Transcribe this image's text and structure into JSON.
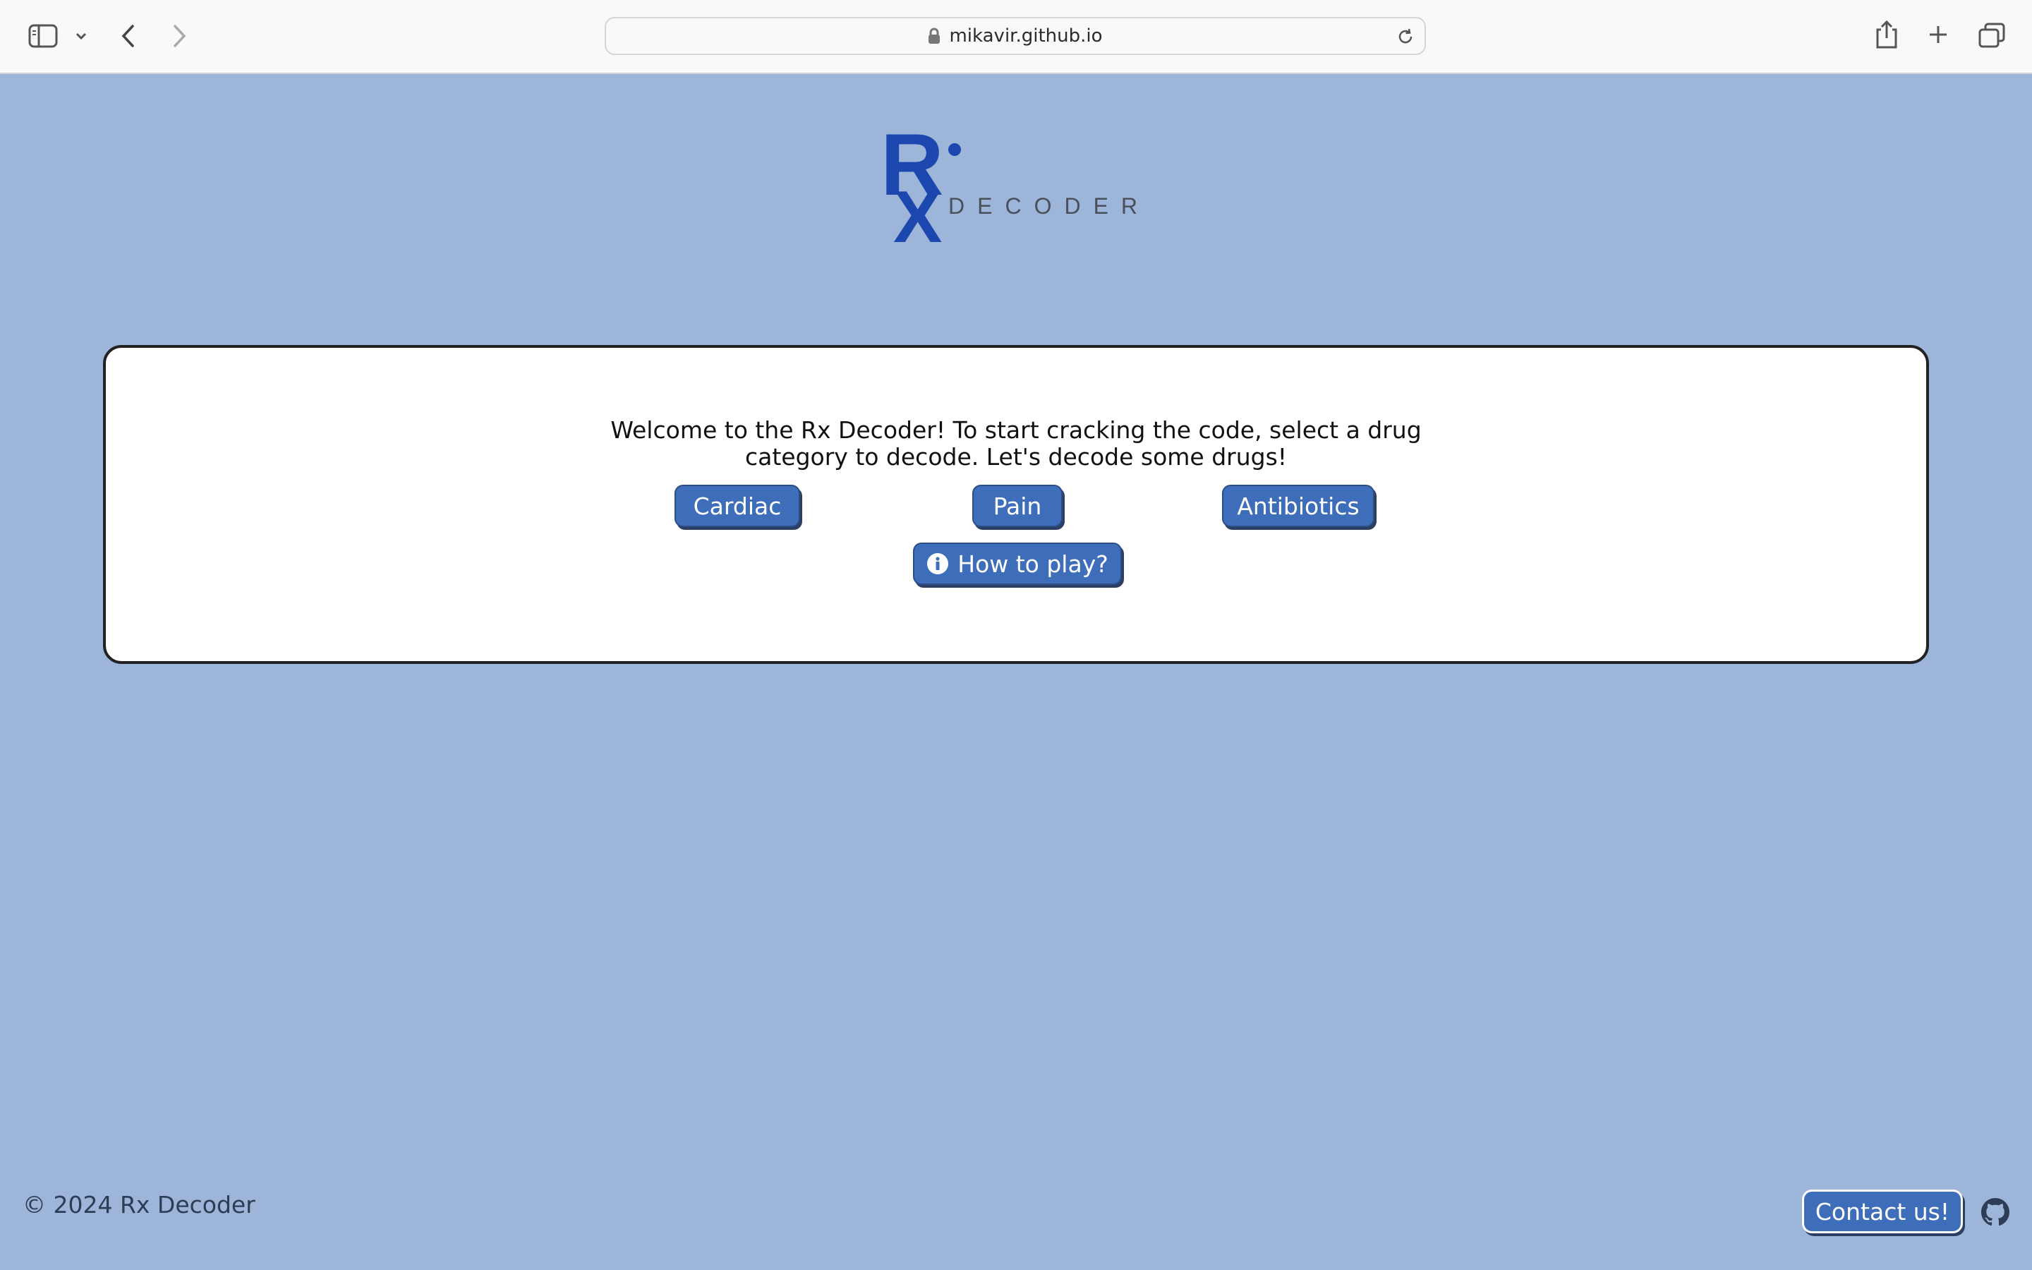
{
  "browser": {
    "url": "mikavir.github.io",
    "icons": [
      "sidebar-icon",
      "chevron-down-icon",
      "back-icon",
      "forward-icon",
      "lock-icon",
      "reload-icon",
      "share-icon",
      "new-tab-icon",
      "tabs-overview-icon"
    ]
  },
  "logo": {
    "mark": "Rx",
    "word": "DECODER",
    "brand_color": "#1c47ae"
  },
  "main": {
    "welcome_line1": "Welcome to the Rx Decoder! To start cracking the code, select a drug",
    "welcome_line2": "category to decode. Let's decode some drugs!",
    "categories": [
      {
        "label": "Cardiac"
      },
      {
        "label": "Pain"
      },
      {
        "label": "Antibiotics"
      }
    ],
    "how_to_play": {
      "label": "How to play?",
      "icon": "info-icon"
    }
  },
  "footer": {
    "copyright": "© 2024 Rx Decoder",
    "contact_label": "Contact us!",
    "github_icon": "github-icon"
  },
  "colors": {
    "page_bg": "#9db5d9",
    "button_bg": "#3e6eb9",
    "card_bg": "#ffffff"
  }
}
